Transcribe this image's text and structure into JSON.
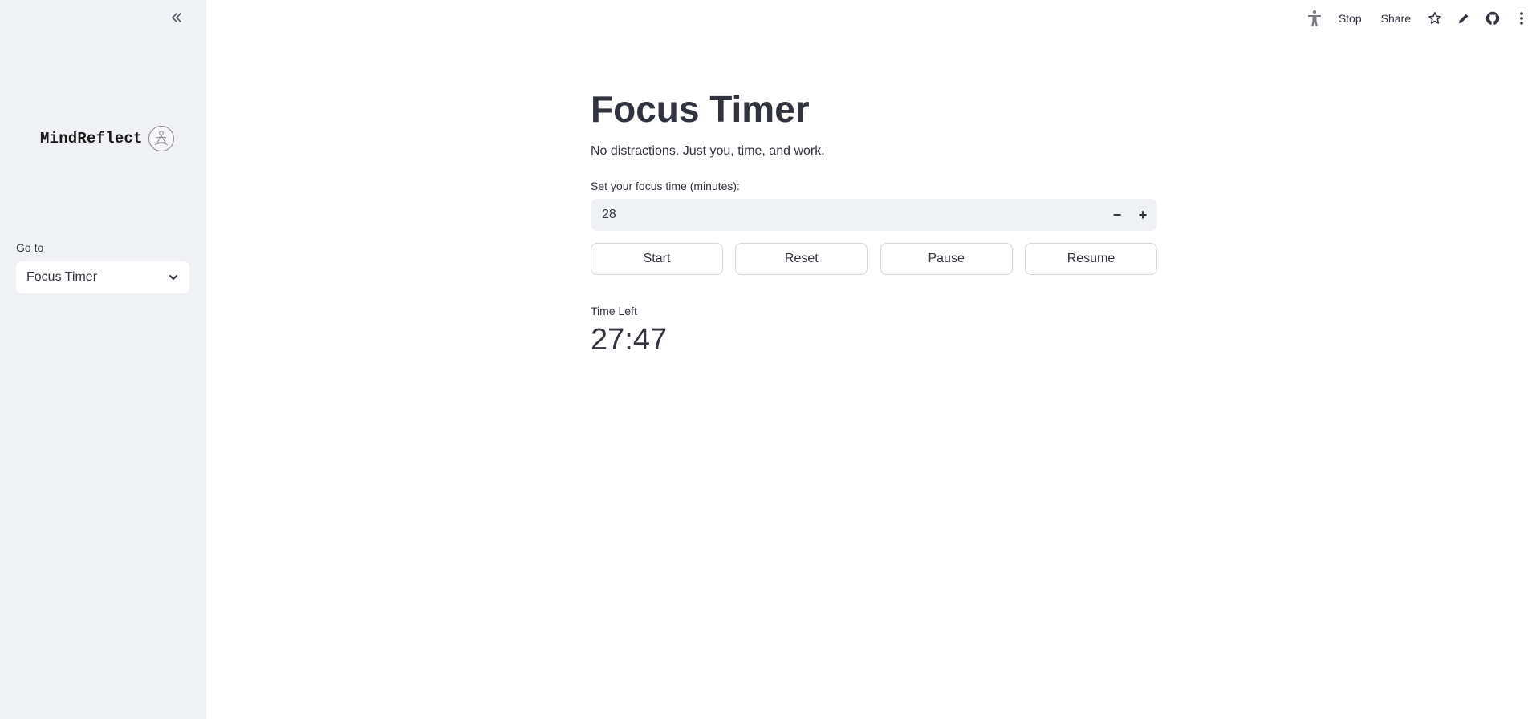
{
  "sidebar": {
    "brand_name": "MindReflect",
    "nav_label": "Go to",
    "nav_selected": "Focus Timer",
    "collapse_icon": "double-chevron-left-icon",
    "dropdown_icon": "chevron-down-icon"
  },
  "toolbar": {
    "stop_label": "Stop",
    "share_label": "Share",
    "icons": [
      "accessibility-icon",
      "star-icon",
      "pencil-icon",
      "github-icon",
      "kebab-menu-icon"
    ]
  },
  "main": {
    "title": "Focus Timer",
    "subtitle": "No distractions. Just you, time, and work.",
    "focus_time": {
      "label": "Set your focus time (minutes):",
      "value": "28",
      "decrement": "−",
      "increment": "+"
    },
    "buttons": {
      "start": "Start",
      "reset": "Reset",
      "pause": "Pause",
      "resume": "Resume"
    },
    "metric": {
      "label": "Time Left",
      "value": "27:47"
    }
  },
  "colors": {
    "sidebar_bg": "#f0f2f6",
    "text": "#31333f",
    "input_bg": "#f0f2f6",
    "button_border": "#d5d6da"
  }
}
